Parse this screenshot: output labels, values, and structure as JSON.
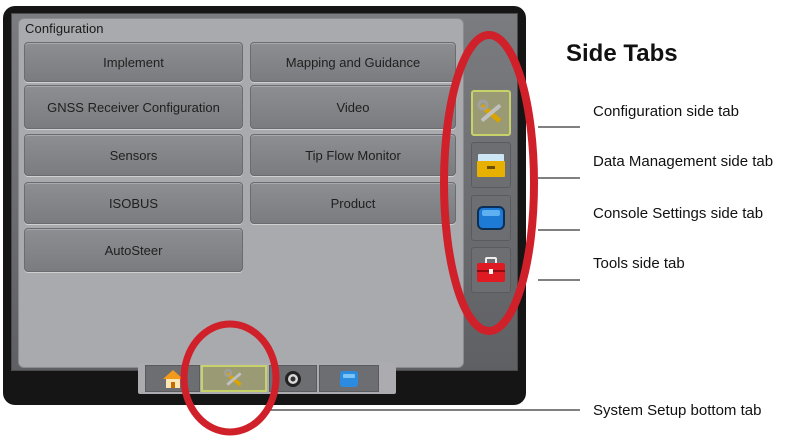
{
  "panel": {
    "title": "Configuration",
    "buttons": {
      "implement": "Implement",
      "mapping": "Mapping and Guidance",
      "gnss": "GNSS Receiver Configuration",
      "video": "Video",
      "sensors": "Sensors",
      "tipflow": "Tip Flow Monitor",
      "isobus": "ISOBUS",
      "product": "Product",
      "autosteer": "AutoSteer"
    }
  },
  "side_tabs": [
    {
      "icon": "tools-icon",
      "active": true
    },
    {
      "icon": "data-management-icon",
      "active": false
    },
    {
      "icon": "console-icon",
      "active": false
    },
    {
      "icon": "toolbox-icon",
      "active": false
    }
  ],
  "bottom_tabs": [
    {
      "icon": "home-icon",
      "active": false
    },
    {
      "icon": "tools-icon",
      "active": true
    },
    {
      "icon": "camera-icon",
      "active": false
    },
    {
      "icon": "data-icon",
      "active": false
    }
  ],
  "annotations": {
    "heading": "Side Tabs",
    "configuration": "Configuration side tab",
    "data_management": "Data Management side tab",
    "console_settings": "Console Settings side tab",
    "tools": "Tools side tab",
    "system_setup": "System Setup bottom tab"
  },
  "colors": {
    "highlight_circle": "#d0202a",
    "active_tab_border": "#c8d26a"
  }
}
